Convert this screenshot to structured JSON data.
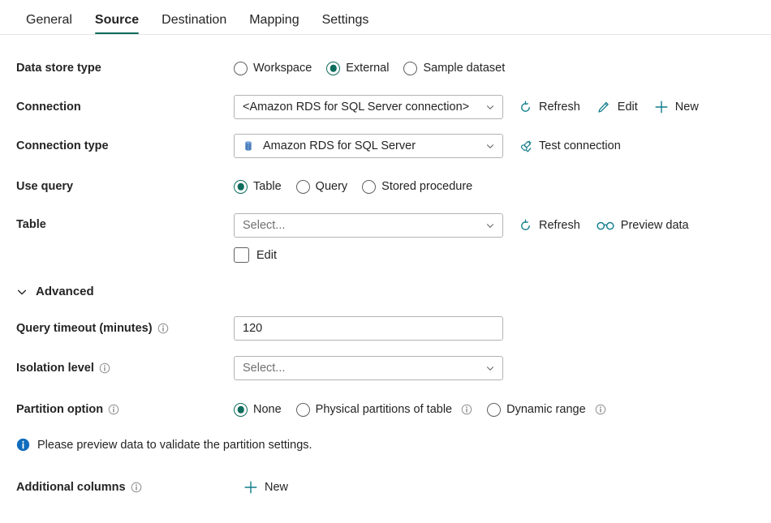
{
  "tabs": [
    {
      "label": "General",
      "active": false
    },
    {
      "label": "Source",
      "active": true
    },
    {
      "label": "Destination",
      "active": false
    },
    {
      "label": "Mapping",
      "active": false
    },
    {
      "label": "Settings",
      "active": false
    }
  ],
  "colors": {
    "accent": "#0f6b5c",
    "icon_teal": "#0f7b8a",
    "info_blue": "#0f6cbd",
    "db_icon_blue": "#4a7ebb",
    "text": "#242424",
    "placeholder": "#707070",
    "border": "#b3b3b3"
  },
  "form": {
    "data_store_type": {
      "label": "Data store type",
      "options": [
        {
          "label": "Workspace",
          "checked": false
        },
        {
          "label": "External",
          "checked": true
        },
        {
          "label": "Sample dataset",
          "checked": false
        }
      ]
    },
    "connection": {
      "label": "Connection",
      "value": "<Amazon RDS for SQL Server connection>",
      "actions": [
        {
          "label": "Refresh",
          "icon": "refresh-icon"
        },
        {
          "label": "Edit",
          "icon": "pencil-icon"
        },
        {
          "label": "New",
          "icon": "plus-icon"
        }
      ]
    },
    "connection_type": {
      "label": "Connection type",
      "value": "Amazon RDS for SQL Server",
      "icon": "database-icon",
      "actions": [
        {
          "label": "Test connection",
          "icon": "plug-check-icon"
        }
      ]
    },
    "use_query": {
      "label": "Use query",
      "options": [
        {
          "label": "Table",
          "checked": true
        },
        {
          "label": "Query",
          "checked": false
        },
        {
          "label": "Stored procedure",
          "checked": false
        }
      ]
    },
    "table": {
      "label": "Table",
      "placeholder": "Select...",
      "actions": [
        {
          "label": "Refresh",
          "icon": "refresh-icon"
        },
        {
          "label": "Preview data",
          "icon": "glasses-icon"
        }
      ],
      "edit_checkbox": {
        "label": "Edit",
        "checked": false
      }
    },
    "advanced": {
      "label": "Advanced",
      "expanded": true
    },
    "query_timeout": {
      "label": "Query timeout (minutes)",
      "value": "120",
      "has_info": true
    },
    "isolation_level": {
      "label": "Isolation level",
      "placeholder": "Select...",
      "has_info": true
    },
    "partition_option": {
      "label": "Partition option",
      "has_info": true,
      "options": [
        {
          "label": "None",
          "checked": true,
          "has_info": false
        },
        {
          "label": "Physical partitions of table",
          "checked": false,
          "has_info": true
        },
        {
          "label": "Dynamic range",
          "checked": false,
          "has_info": true
        }
      ]
    },
    "partition_message": "Please preview data to validate the partition settings.",
    "additional_columns": {
      "label": "Additional columns",
      "has_info": true,
      "actions": [
        {
          "label": "New",
          "icon": "plus-icon"
        }
      ]
    }
  }
}
